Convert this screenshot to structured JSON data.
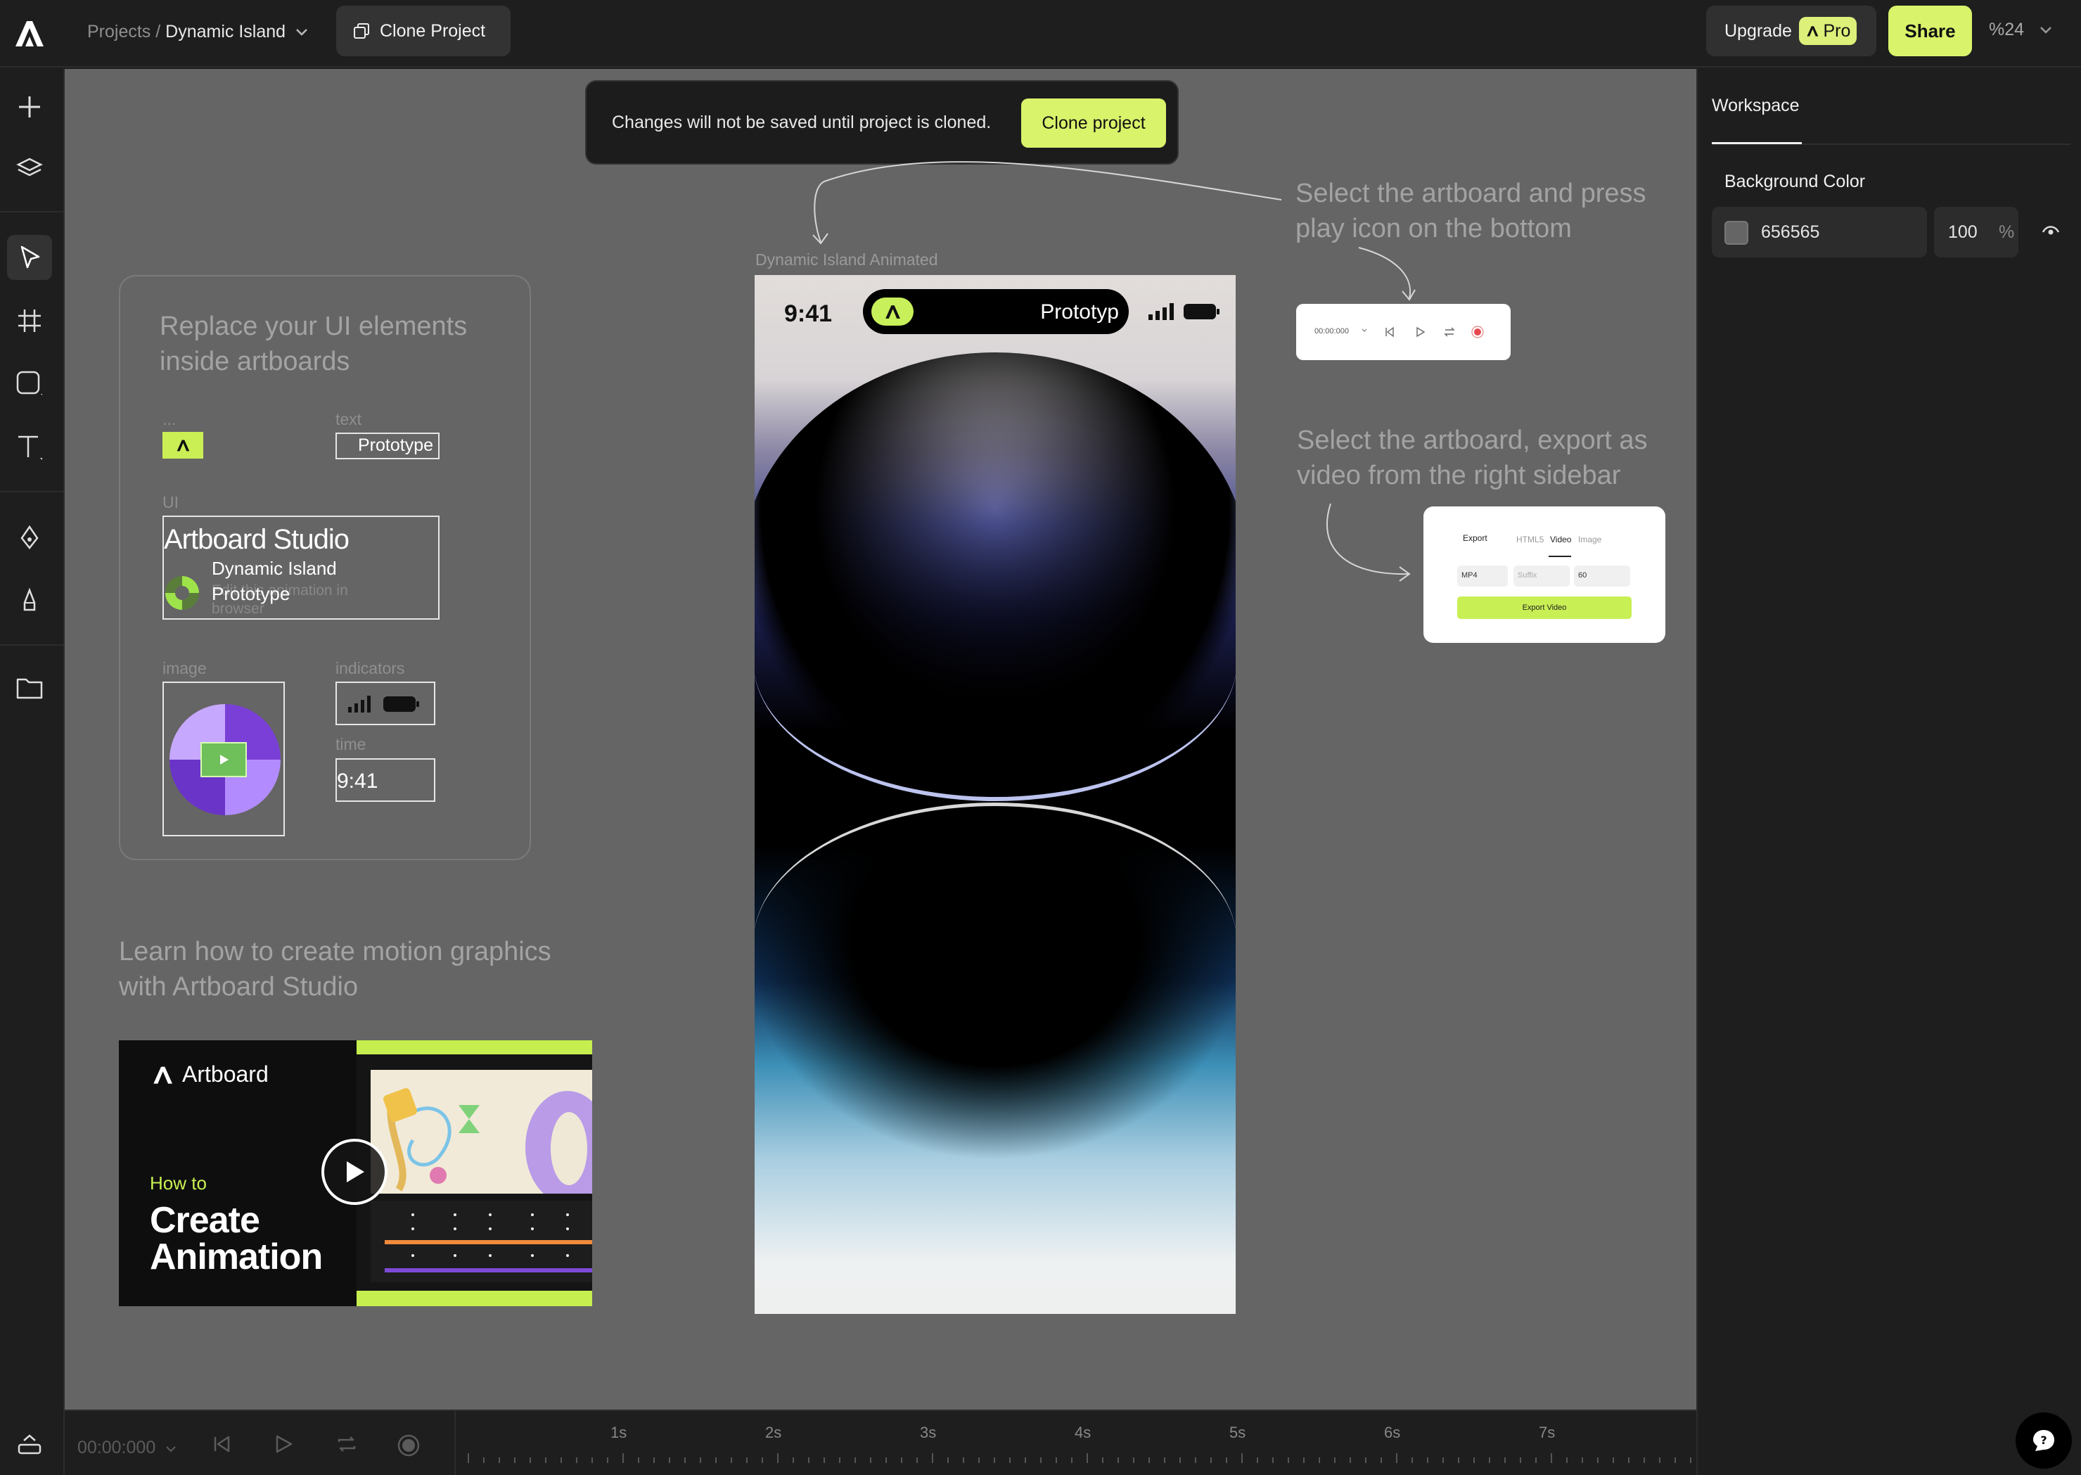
{
  "topbar": {
    "breadcrumb_root": "Projects /",
    "breadcrumb_current": "Dynamic Island",
    "clone_button": "Clone Project",
    "upgrade_label": "Upgrade",
    "pro_badge": "Pro",
    "share_label": "Share",
    "zoom": "%24"
  },
  "left_toolbar": {
    "tools": [
      "add-icon",
      "layers-icon",
      "select-icon",
      "frame-icon",
      "shape-icon",
      "text-icon",
      "pen-icon",
      "pencil-icon",
      "folder-icon"
    ],
    "active_tool": "select-icon"
  },
  "canvas": {
    "background": "#656565",
    "notice": {
      "message": "Changes will not be saved until project is cloned.",
      "button": "Clone project"
    },
    "replace_card": {
      "title": "Replace your UI elements inside artboards",
      "label_dots": "...",
      "label_text": "text",
      "text_frame_value": "Prototype",
      "label_ui": "UI",
      "ui_title": "Artboard Studio",
      "ui_subtitle": "Dynamic Island",
      "ui_desc": "Edit this animation in browser",
      "ui_caption": "Prototype",
      "label_image": "image",
      "label_indicators": "indicators",
      "label_time": "time",
      "time_value": "9:41"
    },
    "learn": {
      "title": "Learn how to create motion graphics with Artboard Studio",
      "brand": "Artboard",
      "how_to": "How to",
      "headline_1": "Create",
      "headline_2": "Animation"
    },
    "artboard": {
      "label": "Dynamic Island Animated",
      "time": "9:41",
      "island_text": "Prototyp"
    },
    "hint_play": "Select the artboard and press play icon on the bottom",
    "player_card": {
      "time": "00:00:000"
    },
    "hint_export": "Select the artboard, export as video from the right sidebar",
    "export_card": {
      "title": "Export",
      "tabs": [
        "HTML5",
        "Video",
        "Image"
      ],
      "format": "MP4",
      "suffix_placeholder": "Suffix",
      "fps": "60",
      "button": "Export Video"
    }
  },
  "right_panel": {
    "tab": "Workspace",
    "background_label": "Background Color",
    "color_hex": "656565",
    "opacity": "100",
    "opacity_unit": "%"
  },
  "timeline": {
    "time": "00:00:000",
    "seconds": [
      "1s",
      "2s",
      "3s",
      "4s",
      "5s",
      "6s",
      "7s"
    ]
  },
  "colors": {
    "accent": "#d9f36b",
    "canvas": "#656565",
    "chrome": "#1e1e1e"
  }
}
